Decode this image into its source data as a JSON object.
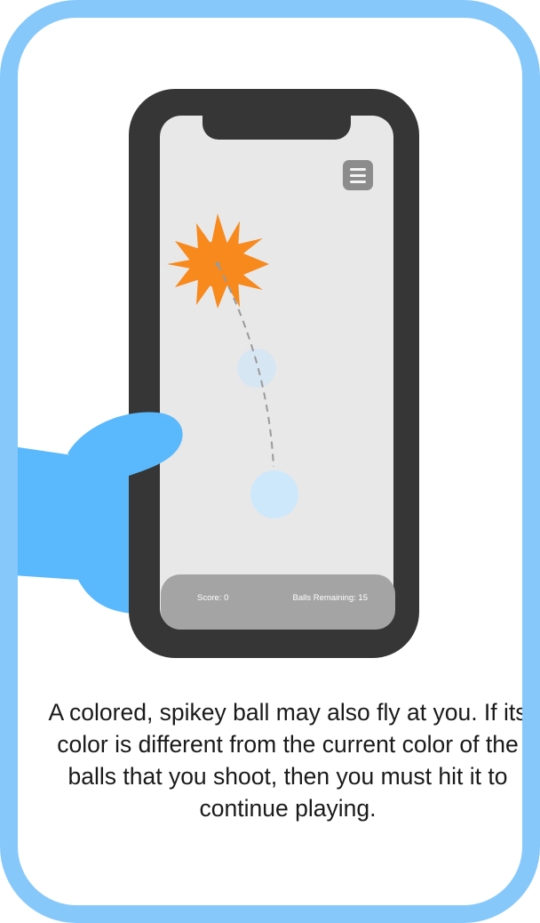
{
  "game": {
    "score_label": "Score: 0",
    "balls_remaining_label": "Balls Remaining: 15",
    "menu_icon": "hamburger-menu-icon",
    "spiky_ball_color": "#f7891d",
    "ball_color": "#cde8fb",
    "ghost_ball_color": "#d7e6f3",
    "trajectory_color": "#9a9a9a"
  },
  "caption": {
    "text": "A colored, spikey ball may also fly at you. If its color is different from the current color of the balls that you shoot, then you must hit it to continue playing."
  },
  "colors": {
    "card_border": "#87c8fb",
    "phone_frame": "#363636",
    "phone_screen": "#e8e8e8",
    "status_bar": "#a4a4a4",
    "hand": "#5ab9fc"
  }
}
